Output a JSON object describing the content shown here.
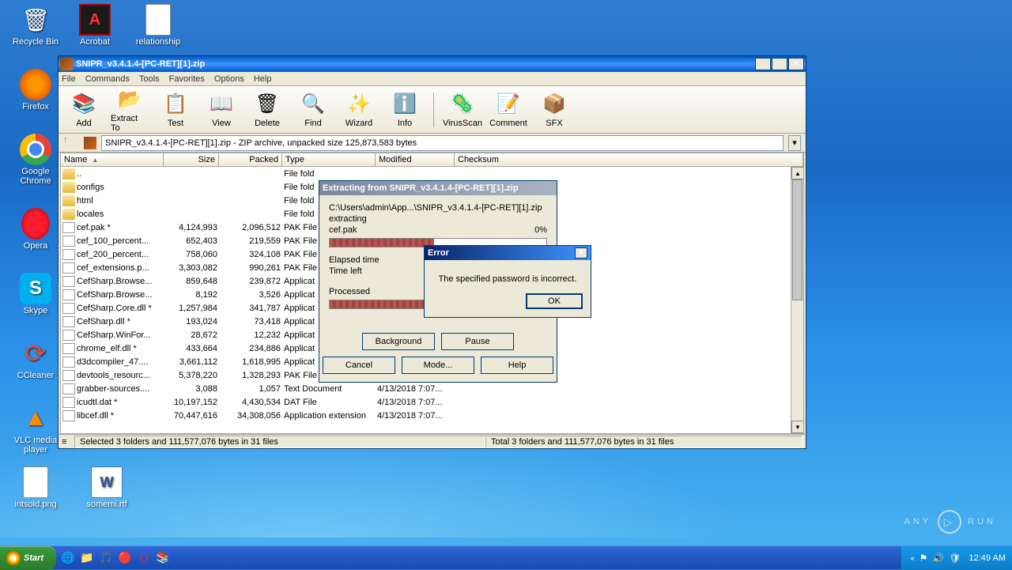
{
  "desktop": {
    "icons": [
      "Recycle Bin",
      "Firefox",
      "Google Chrome",
      "Opera",
      "Skype",
      "CCleaner",
      "VLC media player"
    ],
    "row2": [
      "Acrobat",
      "relationship"
    ],
    "row3": [
      "intsold.png",
      "somemi.rtf"
    ]
  },
  "window": {
    "title": "SNIPR_v3.4.1.4-[PC-RET][1].zip",
    "menu": [
      "File",
      "Commands",
      "Tools",
      "Favorites",
      "Options",
      "Help"
    ],
    "tools": [
      "Add",
      "Extract To",
      "Test",
      "View",
      "Delete",
      "Find",
      "Wizard",
      "Info",
      "VirusScan",
      "Comment",
      "SFX"
    ],
    "path": "SNIPR_v3.4.1.4-[PC-RET][1].zip - ZIP archive, unpacked size 125,873,583 bytes",
    "cols": {
      "name": "Name",
      "size": "Size",
      "packed": "Packed",
      "type": "Type",
      "mod": "Modified",
      "chk": "Checksum"
    },
    "rows": [
      {
        "n": "..",
        "t": "File fold"
      },
      {
        "n": "configs",
        "t": "File fold"
      },
      {
        "n": "html",
        "t": "File fold"
      },
      {
        "n": "locales",
        "t": "File fold"
      },
      {
        "n": "cef.pak *",
        "s": "4,124,993",
        "p": "2,096,512",
        "t": "PAK File"
      },
      {
        "n": "cef_100_percent...",
        "s": "652,403",
        "p": "219,559",
        "t": "PAK File"
      },
      {
        "n": "cef_200_percent...",
        "s": "758,060",
        "p": "324,108",
        "t": "PAK File"
      },
      {
        "n": "cef_extensions.p...",
        "s": "3,303,082",
        "p": "990,261",
        "t": "PAK File"
      },
      {
        "n": "CefSharp.Browse...",
        "s": "859,648",
        "p": "239,872",
        "t": "Applicat"
      },
      {
        "n": "CefSharp.Browse...",
        "s": "8,192",
        "p": "3,526",
        "t": "Applicat"
      },
      {
        "n": "CefSharp.Core.dll *",
        "s": "1,257,984",
        "p": "341,787",
        "t": "Applicat"
      },
      {
        "n": "CefSharp.dll *",
        "s": "193,024",
        "p": "73,418",
        "t": "Applicat"
      },
      {
        "n": "CefSharp.WinFor...",
        "s": "28,672",
        "p": "12,232",
        "t": "Applicat"
      },
      {
        "n": "chrome_elf.dll *",
        "s": "433,664",
        "p": "234,886",
        "t": "Applicat"
      },
      {
        "n": "d3dcompiler_47....",
        "s": "3,661,112",
        "p": "1,618,995",
        "t": "Applicat"
      },
      {
        "n": "devtools_resourc...",
        "s": "5,378,220",
        "p": "1,328,293",
        "t": "PAK File"
      },
      {
        "n": "grabber-sources....",
        "s": "3,088",
        "p": "1,057",
        "t": "Text Document",
        "m": "4/13/2018 7:07..."
      },
      {
        "n": "icudtl.dat *",
        "s": "10,197,152",
        "p": "4,430,534",
        "t": "DAT File",
        "m": "4/13/2018 7:07..."
      },
      {
        "n": "libcef.dll *",
        "s": "70,447,616",
        "p": "34,308,056",
        "t": "Application extension",
        "m": "4/13/2018 7:07..."
      }
    ],
    "status_left": "Selected 3 folders and 111,577,076 bytes in 31 files",
    "status_right": "Total 3 folders and 111,577,076 bytes in 31 files"
  },
  "extract": {
    "title": "Extracting from SNIPR_v3.4.1.4-[PC-RET][1].zip",
    "path": "C:\\Users\\admin\\App...\\SNIPR_v3.4.1.4-[PC-RET][1].zip",
    "action": "extracting",
    "file": "cef.pak",
    "pct": "0%",
    "elapsed_lbl": "Elapsed time",
    "left_lbl": "Time left",
    "processed_lbl": "Processed",
    "btns": {
      "bg": "Background",
      "pause": "Pause",
      "cancel": "Cancel",
      "mode": "Mode...",
      "help": "Help"
    }
  },
  "error": {
    "title": "Error",
    "msg": "The specified password is incorrect.",
    "ok": "OK"
  },
  "taskbar": {
    "start": "Start",
    "time": "12:49 AM"
  },
  "watermark": {
    "text": "ANY",
    "text2": "RUN"
  }
}
